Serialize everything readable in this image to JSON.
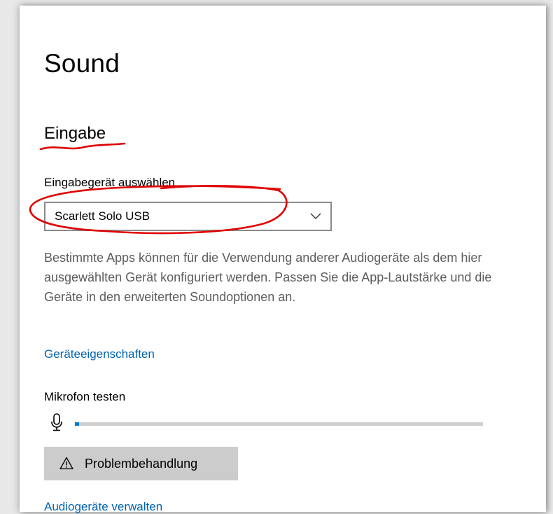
{
  "page": {
    "title": "Sound"
  },
  "input_section": {
    "heading": "Eingabe",
    "device_label": "Eingabegerät auswählen",
    "selected_device": "Scarlett Solo USB",
    "description": "Bestimmte Apps können für die Verwendung anderer Audiogeräte als dem hier ausgewählten Gerät konfiguriert werden. Passen Sie die App-Lautstärke und die Geräte in den erweiterten Soundoptionen an.",
    "device_properties_link": "Geräteeigenschaften",
    "mic_test_label": "Mikrofon testen",
    "mic_level_percent": 1,
    "troubleshoot_button": "Problembehandlung",
    "manage_devices_link": "Audiogeräte verwalten"
  },
  "icons": {
    "dropdown": "chevron-down-icon",
    "microphone": "microphone-icon",
    "troubleshoot": "warning-triangle-icon"
  },
  "colors": {
    "link": "#0063b1",
    "accent": "#0078d7",
    "annotation": "#e00000",
    "description_text": "#5c5c5c",
    "button_bg": "#cccccc"
  }
}
